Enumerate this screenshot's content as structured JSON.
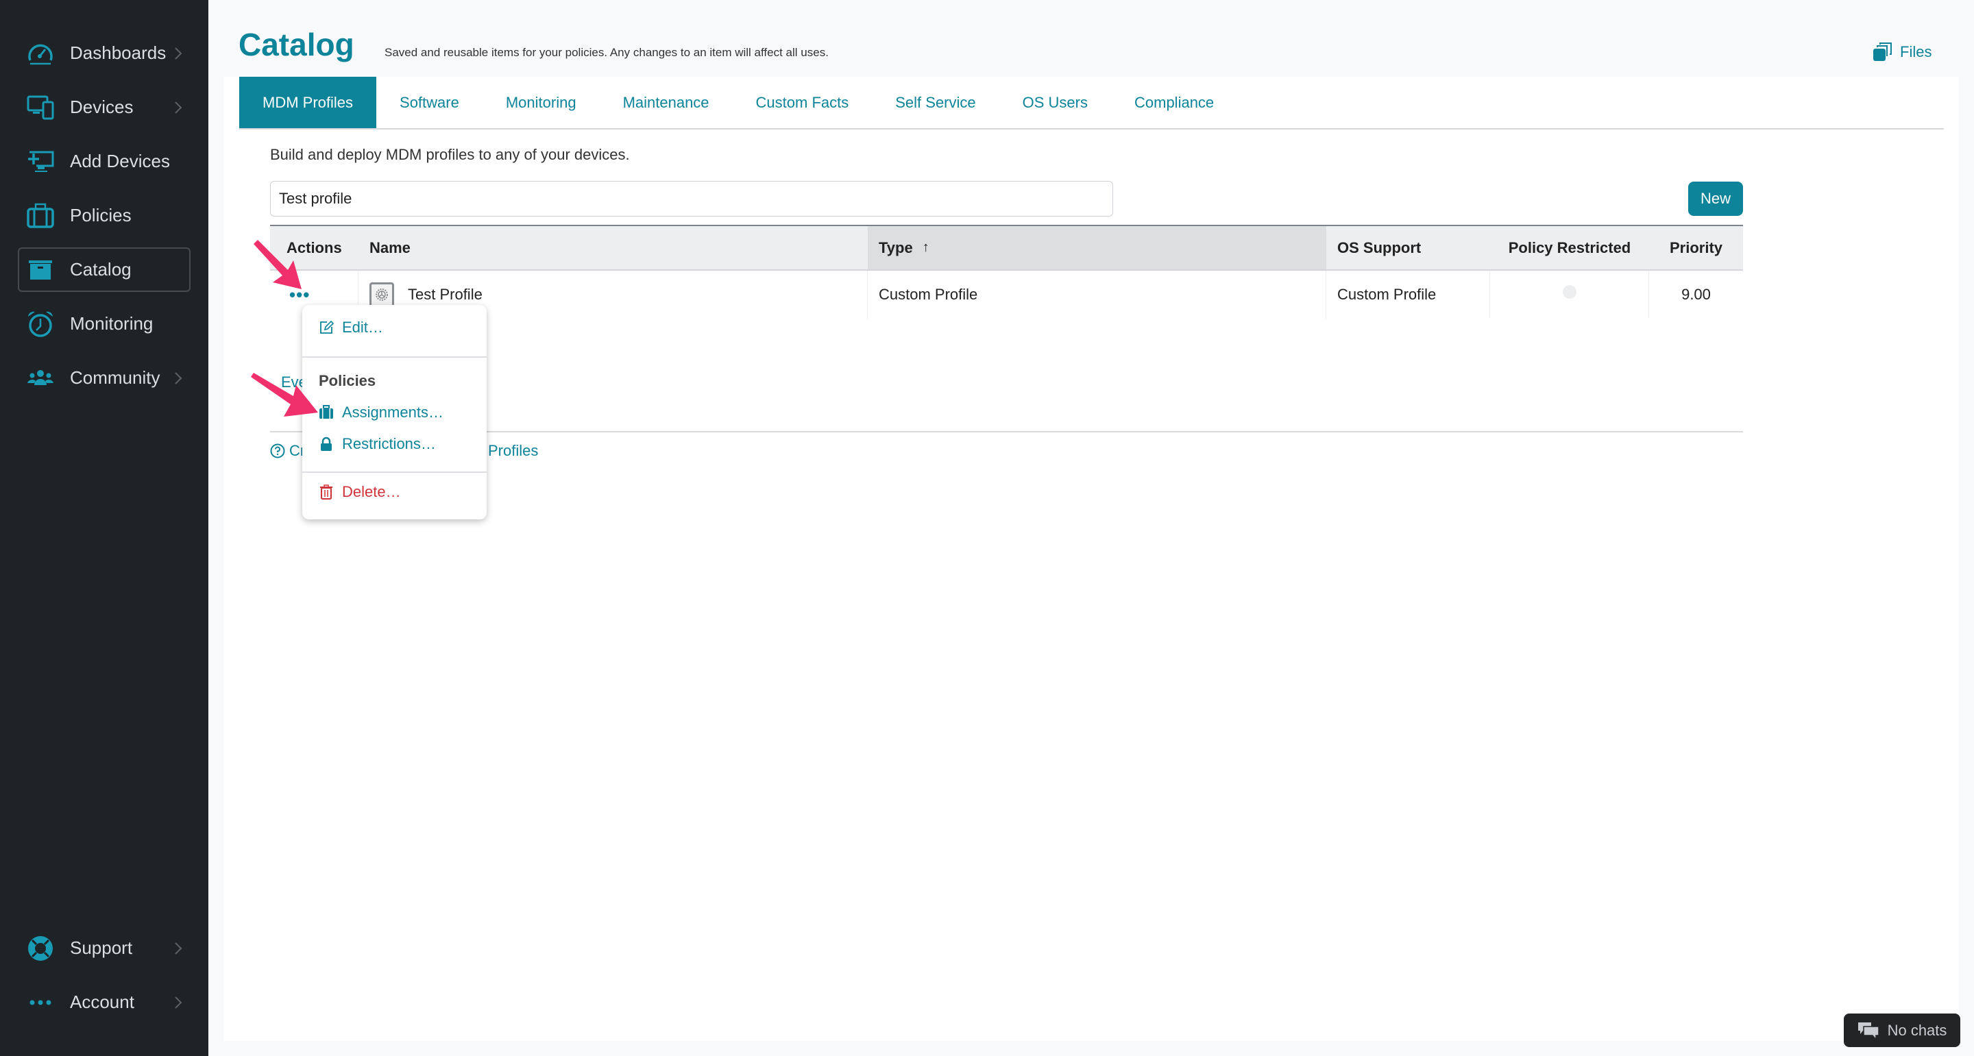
{
  "sidebar": {
    "items": [
      {
        "label": "Dashboards",
        "icon": "gauge-icon",
        "has_chevron": true
      },
      {
        "label": "Devices",
        "icon": "devices-icon",
        "has_chevron": true
      },
      {
        "label": "Add Devices",
        "icon": "add-device-icon",
        "has_chevron": false
      },
      {
        "label": "Policies",
        "icon": "briefcase-icon",
        "has_chevron": false
      },
      {
        "label": "Catalog",
        "icon": "archive-box-icon",
        "has_chevron": false,
        "active": true
      },
      {
        "label": "Monitoring",
        "icon": "alarm-clock-icon",
        "has_chevron": false
      },
      {
        "label": "Community",
        "icon": "users-icon",
        "has_chevron": true
      }
    ],
    "bottom_items": [
      {
        "label": "Support",
        "icon": "lifebuoy-icon",
        "has_chevron": true
      },
      {
        "label": "Account",
        "icon": "more-dots-icon",
        "has_chevron": true
      }
    ]
  },
  "header": {
    "title": "Catalog",
    "subtitle": "Saved and reusable items for your policies. Any changes to an item will affect all uses.",
    "files_label": "Files"
  },
  "tabs": [
    {
      "label": "MDM Profiles",
      "active": true
    },
    {
      "label": "Software"
    },
    {
      "label": "Monitoring"
    },
    {
      "label": "Maintenance"
    },
    {
      "label": "Custom Facts"
    },
    {
      "label": "Self Service"
    },
    {
      "label": "OS Users"
    },
    {
      "label": "Compliance"
    }
  ],
  "main": {
    "intro": "Build and deploy MDM profiles to any of your devices.",
    "search_value": "Test profile",
    "new_button": "New",
    "everything_link_fragment": "Eve",
    "help_link_fragment_start": "Cr",
    "help_link_fragment_end": "Profiles"
  },
  "table": {
    "columns": [
      {
        "label": "Actions"
      },
      {
        "label": "Name"
      },
      {
        "label": "Type",
        "sort": "↑"
      },
      {
        "label": "OS Support"
      },
      {
        "label": "Policy Restricted"
      },
      {
        "label": "Priority"
      }
    ],
    "rows": [
      {
        "actions": "•••",
        "name": "Test Profile",
        "type": "Custom Profile",
        "os_support": "Custom Profile",
        "policy_restricted": false,
        "priority": "9.00"
      }
    ]
  },
  "menu": {
    "edit": "Edit…",
    "section_heading": "Policies",
    "assignments": "Assignments…",
    "restrictions": "Restrictions…",
    "delete": "Delete…"
  },
  "chat": {
    "label": "No chats"
  },
  "colors": {
    "accent": "#0d849a",
    "sidebar_bg": "#1d2327",
    "danger": "#d0343a",
    "annotation_arrow": "#f0306a"
  }
}
